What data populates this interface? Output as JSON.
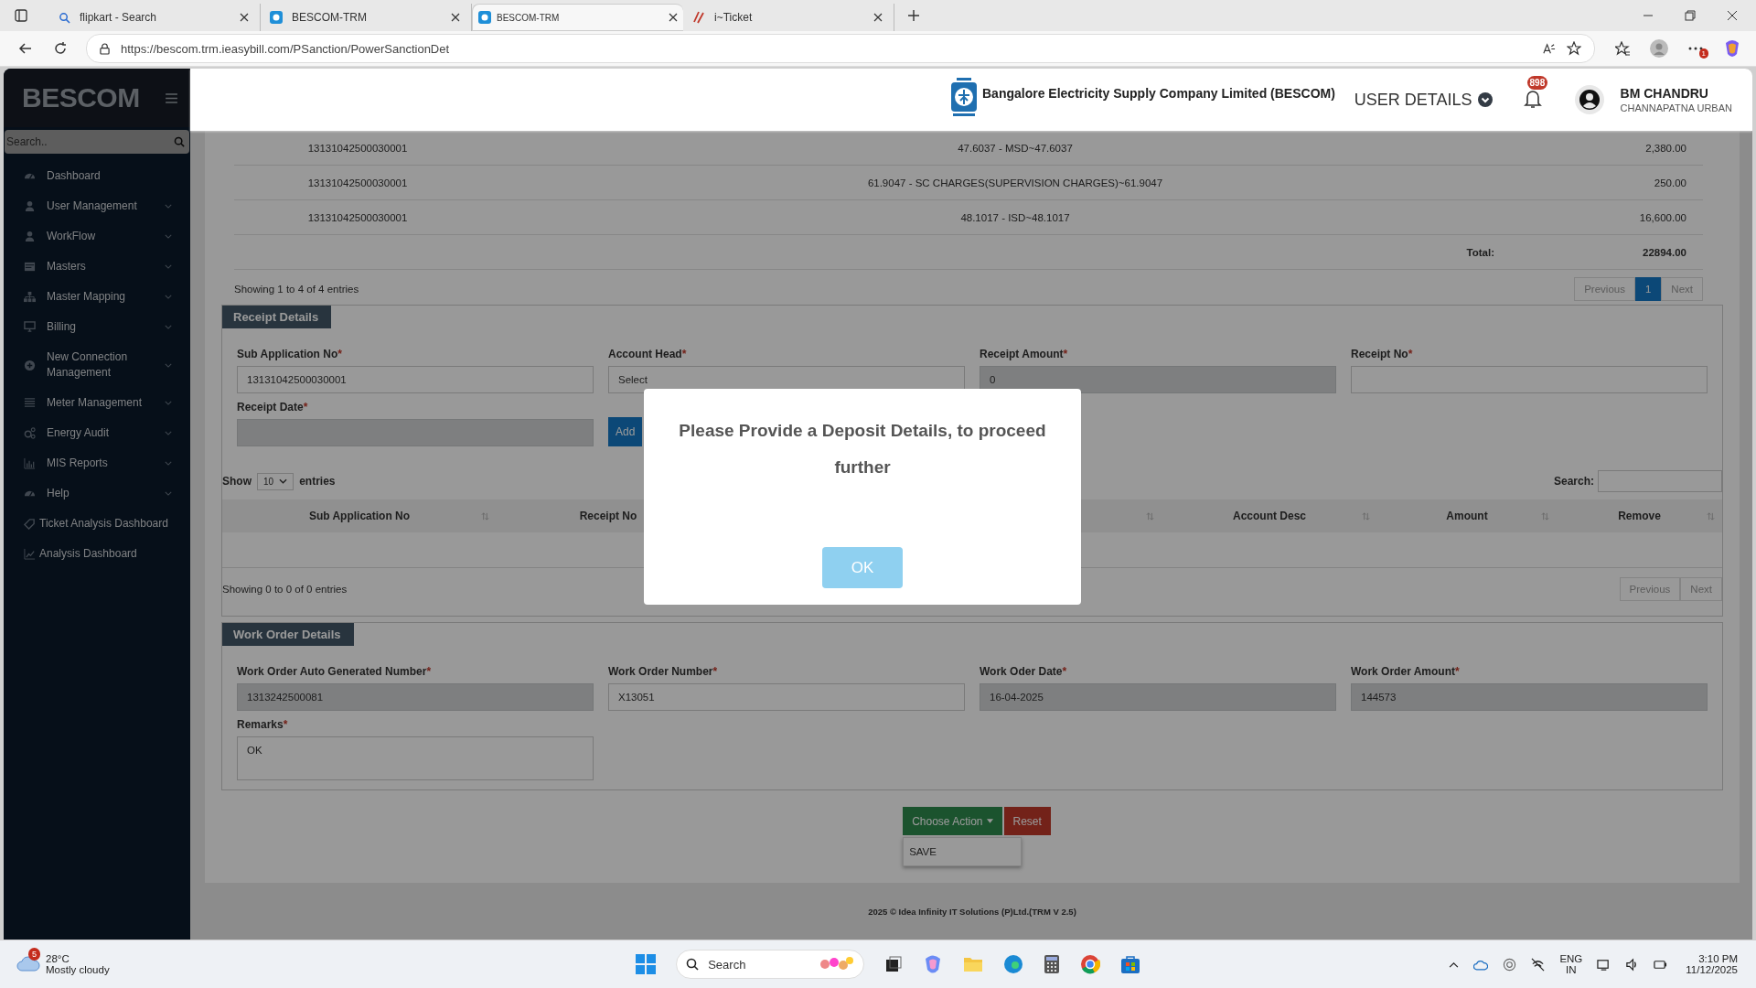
{
  "browser": {
    "tabs": [
      {
        "title": "flipkart - Search",
        "kind": "search",
        "selected": false
      },
      {
        "title": "BESCOM-TRM",
        "kind": "site",
        "selected": false
      },
      {
        "title": "BESCOM-TRM",
        "kind": "site",
        "selected": true
      },
      {
        "title": "i~Ticket",
        "kind": "ticket",
        "selected": false
      }
    ],
    "url": "https://bescom.trm.ieasybill.com/PSanction/PowerSanctionDet",
    "profile_badge": "1"
  },
  "sidebar": {
    "logo": "BESCOM",
    "search_placeholder": "Search..",
    "items": [
      {
        "label": "Dashboard",
        "kind": "gauge",
        "has_submenu": false
      },
      {
        "label": "User Management",
        "kind": "user",
        "has_submenu": true
      },
      {
        "label": "WorkFlow",
        "kind": "user",
        "has_submenu": true
      },
      {
        "label": "Masters",
        "kind": "card",
        "has_submenu": true
      },
      {
        "label": "Master Mapping",
        "kind": "sitemap",
        "has_submenu": true
      },
      {
        "label": "Billing",
        "kind": "monitor",
        "has_submenu": true
      },
      {
        "label": "New Connection Management",
        "kind": "plus",
        "has_submenu": true
      },
      {
        "label": "Meter Management",
        "kind": "list",
        "has_submenu": true
      },
      {
        "label": "Energy Audit",
        "kind": "gears",
        "has_submenu": true
      },
      {
        "label": "MIS Reports",
        "kind": "bars",
        "has_submenu": true
      },
      {
        "label": "Help",
        "kind": "gauge",
        "has_submenu": true
      },
      {
        "label": "Ticket Analysis Dashboard",
        "kind": "tag",
        "has_submenu": false
      },
      {
        "label": "Analysis Dashboard",
        "kind": "chart",
        "has_submenu": false
      }
    ]
  },
  "header": {
    "company": "Bangalore Electricity Supply Company Limited (BESCOM)",
    "user_details": "USER DETAILS",
    "notification_count": "898",
    "user_name": "BM CHANDRU",
    "user_location": "CHANNAPATNA URBAN"
  },
  "charges": {
    "rows": [
      {
        "sub_application_no": "13131042500030001",
        "description": "47.6037 - MSD~47.6037",
        "amount": "2,380.00"
      },
      {
        "sub_application_no": "13131042500030001",
        "description": "61.9047 - SC CHARGES(SUPERVISION CHARGES)~61.9047",
        "amount": "250.00"
      },
      {
        "sub_application_no": "13131042500030001",
        "description": "48.1017 - ISD~48.1017",
        "amount": "16,600.00"
      }
    ],
    "total_label": "Total:",
    "total_value": "22894.00",
    "info": "Showing 1 to 4 of 4 entries",
    "pages": [
      {
        "label": "Previous",
        "selected": false
      },
      {
        "label": "1",
        "selected": true
      },
      {
        "label": "Next",
        "selected": false
      }
    ]
  },
  "receipt": {
    "title": "Receipt Details",
    "fields": [
      {
        "label": "Sub Application No",
        "mark": "*",
        "kind": "text",
        "disabled": false,
        "value": "13131042500030001"
      },
      {
        "label": "Account Head",
        "mark": "*",
        "kind": "text",
        "disabled": false,
        "value": "Select"
      },
      {
        "label": "Receipt Amount",
        "mark": "*",
        "kind": "text",
        "disabled": true,
        "value": "0"
      },
      {
        "label": "Receipt No",
        "mark": "*",
        "kind": "text",
        "disabled": false
      },
      {
        "label": "Receipt Date",
        "mark": "*",
        "kind": "text",
        "disabled": true
      }
    ],
    "add_button": "Add",
    "show_label": "Show",
    "page_size": "10",
    "entries_label": "entries",
    "search_label": "Search:",
    "columns": [
      {
        "label": "Sub Application No",
        "sortable": true
      },
      {
        "label": "Receipt No"
      },
      {
        "sortable": true
      },
      {
        "label": "Account Desc",
        "sortable": true
      },
      {
        "label": "Amount",
        "sortable": true
      },
      {
        "label": "Remove",
        "sortable": true
      }
    ],
    "info": "Showing 0 to 0 of 0 entries",
    "pages": [
      {
        "label": "Previous",
        "selected": false
      },
      {
        "label": "Next",
        "selected": false
      }
    ]
  },
  "work_order": {
    "title": "Work Order Details",
    "fields": [
      {
        "label": "Work Order Auto Generated Number",
        "mark": "*",
        "kind": "text",
        "disabled": true,
        "value": "1313242500081"
      },
      {
        "label": "Work Order Number",
        "mark": "*",
        "kind": "text",
        "disabled": false,
        "value": "X13051"
      },
      {
        "label": "Work Oder Date",
        "mark": "*",
        "kind": "text",
        "disabled": true,
        "value": "16-04-2025"
      },
      {
        "label": "Work Order Amount",
        "mark": "*",
        "kind": "text",
        "disabled": true,
        "value": "144573"
      },
      {
        "label": "Remarks",
        "mark": "*",
        "kind": "textarea",
        "disabled": false,
        "value": "OK"
      }
    ]
  },
  "actions": {
    "choose": "Choose Action",
    "reset": "Reset",
    "menu": [
      "SAVE"
    ]
  },
  "footer": "2025 © Idea Infinity IT Solutions (P)Ltd.(TRM V 2.5)",
  "modal": {
    "message": "Please Provide a Deposit Details, to proceed further",
    "ok": "OK"
  },
  "taskbar": {
    "weather_badge": "5",
    "temperature": "28°C",
    "condition": "Mostly cloudy",
    "search": "Search",
    "language": "ENG",
    "region": "IN",
    "time": "3:10 PM",
    "date": "11/12/2025"
  }
}
